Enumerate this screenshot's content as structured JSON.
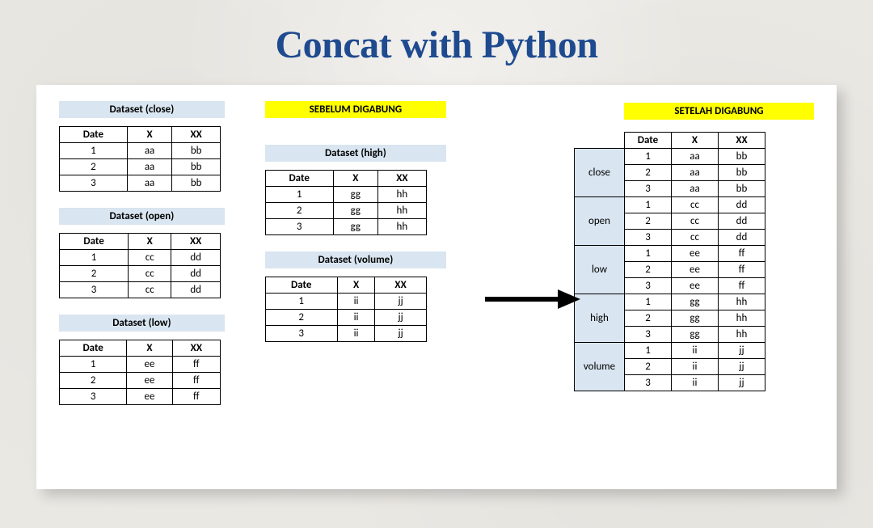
{
  "title": "Concat with Python",
  "labels": {
    "before": "SEBELUM DIGABUNG",
    "after": "SETELAH DIGABUNG"
  },
  "col_headers": [
    "Date",
    "X",
    "XX"
  ],
  "datasets": {
    "close": {
      "label": "Dataset (close)",
      "rows": [
        [
          "1",
          "aa",
          "bb"
        ],
        [
          "2",
          "aa",
          "bb"
        ],
        [
          "3",
          "aa",
          "bb"
        ]
      ]
    },
    "open": {
      "label": "Dataset (open)",
      "rows": [
        [
          "1",
          "cc",
          "dd"
        ],
        [
          "2",
          "cc",
          "dd"
        ],
        [
          "3",
          "cc",
          "dd"
        ]
      ]
    },
    "low": {
      "label": "Dataset (low)",
      "rows": [
        [
          "1",
          "ee",
          "ff"
        ],
        [
          "2",
          "ee",
          "ff"
        ],
        [
          "3",
          "ee",
          "ff"
        ]
      ]
    },
    "high": {
      "label": "Dataset (high)",
      "rows": [
        [
          "1",
          "gg",
          "hh"
        ],
        [
          "2",
          "gg",
          "hh"
        ],
        [
          "3",
          "gg",
          "hh"
        ]
      ]
    },
    "volume": {
      "label": "Dataset (volume)",
      "rows": [
        [
          "1",
          "ii",
          "jj"
        ],
        [
          "2",
          "ii",
          "jj"
        ],
        [
          "3",
          "ii",
          "jj"
        ]
      ]
    }
  },
  "merged": {
    "groups": [
      "close",
      "open",
      "low",
      "high",
      "volume"
    ],
    "rows": [
      [
        "close",
        "1",
        "aa",
        "bb"
      ],
      [
        "close",
        "2",
        "aa",
        "bb"
      ],
      [
        "close",
        "3",
        "aa",
        "bb"
      ],
      [
        "open",
        "1",
        "cc",
        "dd"
      ],
      [
        "open",
        "2",
        "cc",
        "dd"
      ],
      [
        "open",
        "3",
        "cc",
        "dd"
      ],
      [
        "low",
        "1",
        "ee",
        "ff"
      ],
      [
        "low",
        "2",
        "ee",
        "ff"
      ],
      [
        "low",
        "3",
        "ee",
        "ff"
      ],
      [
        "high",
        "1",
        "gg",
        "hh"
      ],
      [
        "high",
        "2",
        "gg",
        "hh"
      ],
      [
        "high",
        "3",
        "gg",
        "hh"
      ],
      [
        "volume",
        "1",
        "ii",
        "jj"
      ],
      [
        "volume",
        "2",
        "ii",
        "jj"
      ],
      [
        "volume",
        "3",
        "ii",
        "jj"
      ]
    ]
  }
}
